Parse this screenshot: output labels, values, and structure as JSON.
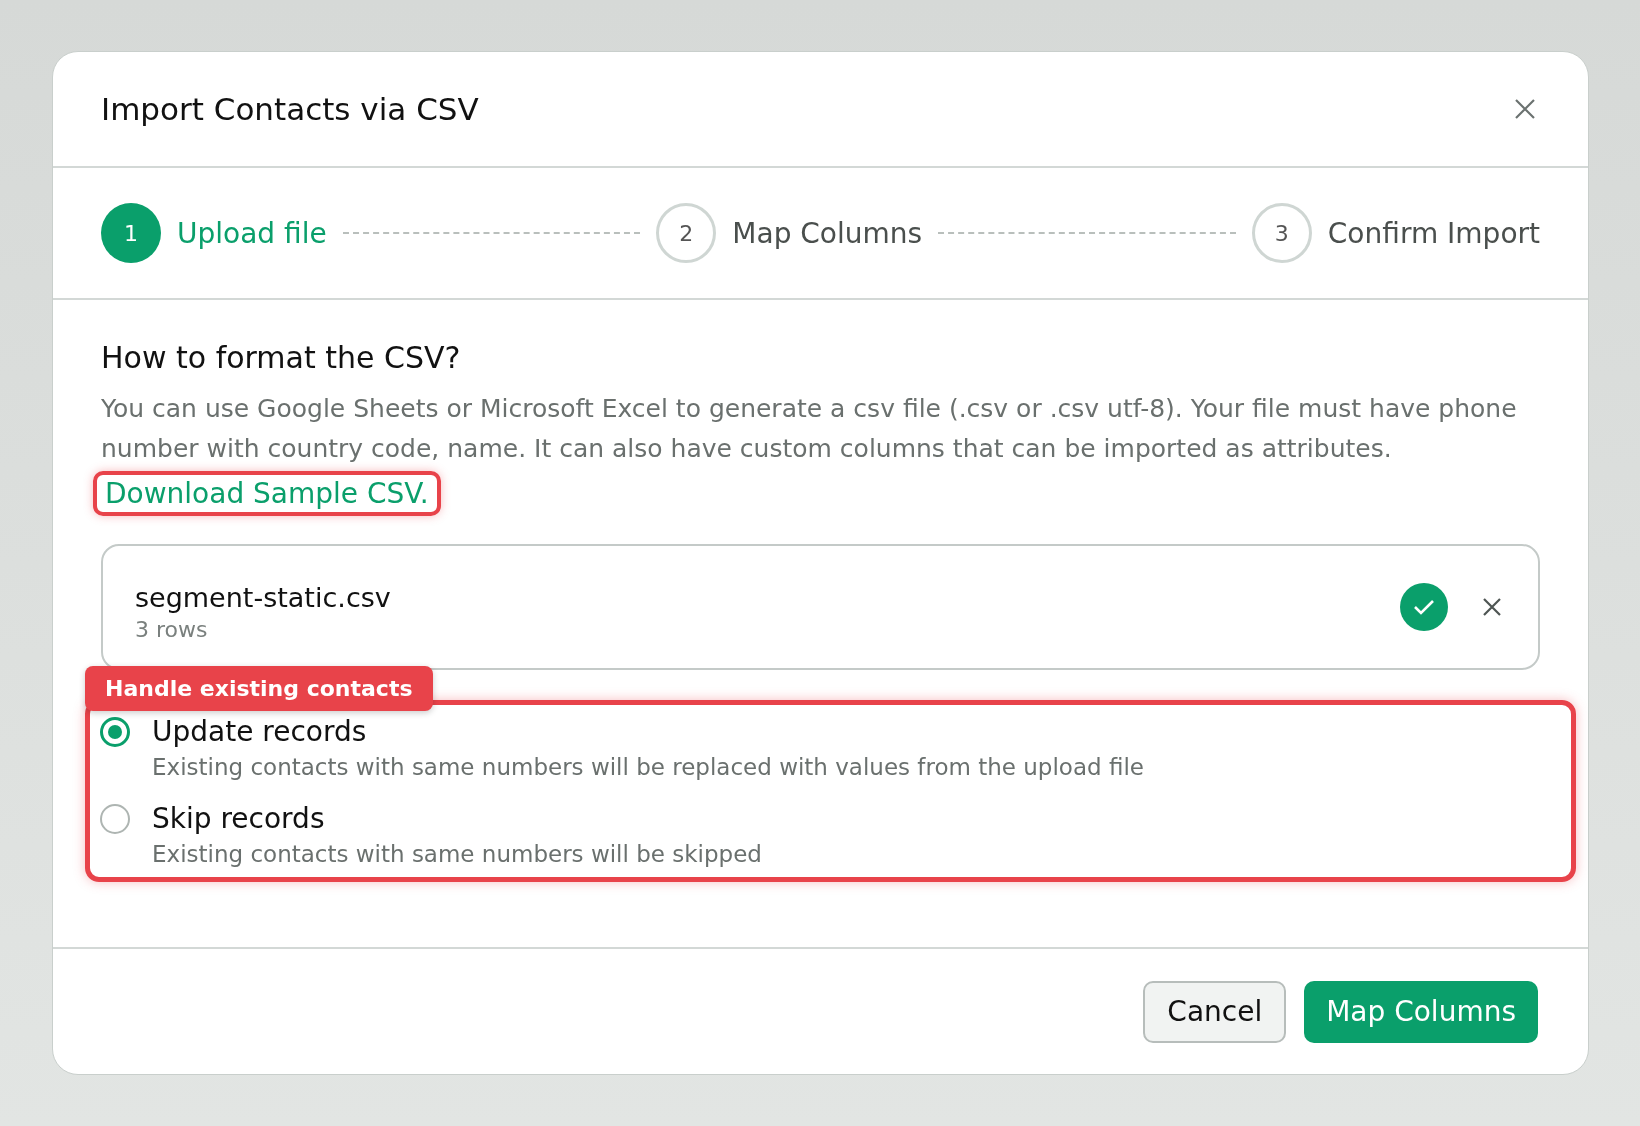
{
  "dialog": {
    "title": "Import Contacts via CSV"
  },
  "steps": [
    {
      "number": "1",
      "label": "Upload file",
      "selected": true
    },
    {
      "number": "2",
      "label": "Map Columns",
      "selected": false
    },
    {
      "number": "3",
      "label": "Confirm Import",
      "selected": false
    }
  ],
  "section": {
    "heading": "How to format the CSV?",
    "description": "You can use Google Sheets or Microsoft Excel to generate a csv file (.csv or .csv utf-8). Your file must have phone number with country code, name. It can also have custom columns that can be imported as attributes.",
    "link": "Download Sample CSV."
  },
  "file": {
    "name": "segment-static.csv",
    "rows": "3 rows",
    "uploaded": true
  },
  "annotation": {
    "label": "Handle existing contacts"
  },
  "options": [
    {
      "label": "Update records",
      "description": "Existing contacts with same numbers will be replaced with values from the upload file",
      "selected": true
    },
    {
      "label": "Skip records",
      "description": "Existing contacts with same numbers will be skipped",
      "selected": false
    }
  ],
  "buttons": [
    {
      "label": "Cancel",
      "kind": "secondary"
    },
    {
      "label": "Map Columns",
      "kind": "primary"
    }
  ]
}
